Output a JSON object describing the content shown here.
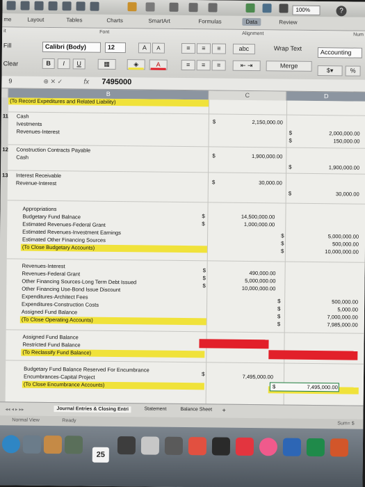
{
  "toolbar": {
    "zoom": "100%",
    "help": "?"
  },
  "ribbon_tabs": [
    "me",
    "Layout",
    "Tables",
    "Charts",
    "SmartArt",
    "Formulas",
    "Data",
    "Review"
  ],
  "ribbon": {
    "font_group": "Font",
    "alignment_group": "Alignment",
    "number_group": "Num",
    "edit_group": "it",
    "fill": "Fill",
    "clear": "Clear",
    "font_name": "Calibri (Body)",
    "font_size": "12",
    "grow": "A",
    "shrink": "A",
    "bold": "B",
    "italic": "I",
    "underline": "U",
    "wrap_glyph": "abc",
    "wrap_text": "Wrap Text",
    "merge": "Merge",
    "number_format": "Accounting",
    "percent": "%"
  },
  "formula_bar": {
    "cell_ref": "9",
    "fx": "fx",
    "value": "7495000"
  },
  "columns": {
    "b": "B",
    "c": "C",
    "d": "D"
  },
  "sheet": {
    "row1": {
      "num": "",
      "label": "(To Record Expeditures and Related Liability)"
    },
    "r11": {
      "num": "11",
      "l1": "Cash",
      "l2": "Ivestments",
      "l3": "Revenues-Interest",
      "d1": "$",
      "c1": "2,150,000.00",
      "d2": "$",
      "v2": "2,000,000.00",
      "d3": "$",
      "v3": "150,000.00"
    },
    "r12": {
      "num": "12",
      "l1": "Construction Contracts Payable",
      "l2": "Cash",
      "d1": "$",
      "c1": "1,900,000.00",
      "d2": "$",
      "v2": "1,900,000.00"
    },
    "r13": {
      "num": "13",
      "l1": "Interest Receivable",
      "l2": "Revenue-Interest",
      "d1": "$",
      "c1": "30,000.00",
      "d2": "$",
      "v2": "30,000.00"
    },
    "approp": {
      "l1": "Appropriations",
      "l2": "Budgetary Fund Balnace",
      "l3": "Estimated Revenues-Federal Grant",
      "l4": "Estimated Revenues-Investment Earnings",
      "l5": "Estimated Other Financing Sources",
      "l6": "(To Close Budgetary Accounts)",
      "d1": "$",
      "c1": "14,500,000.00",
      "d2": "$",
      "c2": "1,000,000.00",
      "d3": "$",
      "v3": "5,000,000.00",
      "d4": "$",
      "v4": "500,000.00",
      "d5": "$",
      "v5": "10,000,000.00"
    },
    "oper": {
      "l1": "Revenues-Interest",
      "l2": "Revenues-Federal Grant",
      "l3": "Other Financing Sources-Long Term Debt Issued",
      "l4": "Other Financing Use-Bond Issue Discount",
      "l5": "Expenditures-Architect Fees",
      "l6": "Expenditures-Construction Costs",
      "l7": "Assigned Fund Balance",
      "l8": "(To Close Operating Accounts)",
      "d1": "$",
      "c1": "490,000.00",
      "d2": "$",
      "c2": "5,000,000.00",
      "d3": "$",
      "c3": "10,000,000.00",
      "d4": "$",
      "v4": "500,000.00",
      "d5": "$",
      "v5": "5,000.00",
      "d6": "$",
      "v6": "7,000,000.00",
      "d7": "$",
      "v7": "7,985,000.00"
    },
    "reclass": {
      "l1": "Assigned Fund Balance",
      "l2": "Restricted Fund Balance",
      "l3": "(To Reclassify Fund Balance)"
    },
    "encumb": {
      "l1": "Budgetary Fund Balance Reserved For Encumbrance",
      "l2": "Encumbrances-Capital Project",
      "l3": "(To Close Encumbrance Accounts)",
      "d1": "$",
      "c1": "7,495,000.00",
      "d2": "$",
      "v2": "7,495,000.00"
    }
  },
  "sheet_tabs": {
    "active": "Journal Entries & Closing Entri",
    "t2": "Statement",
    "t3": "Balance Sheet",
    "add": "+"
  },
  "status": {
    "view": "Normal View",
    "ready": "Ready",
    "sum": "Sum= $"
  },
  "dock": {
    "calendar_day": "25"
  },
  "colors": {
    "yellow": "#f0e23a",
    "red": "#e2202a",
    "green": "#1a7a3a"
  }
}
